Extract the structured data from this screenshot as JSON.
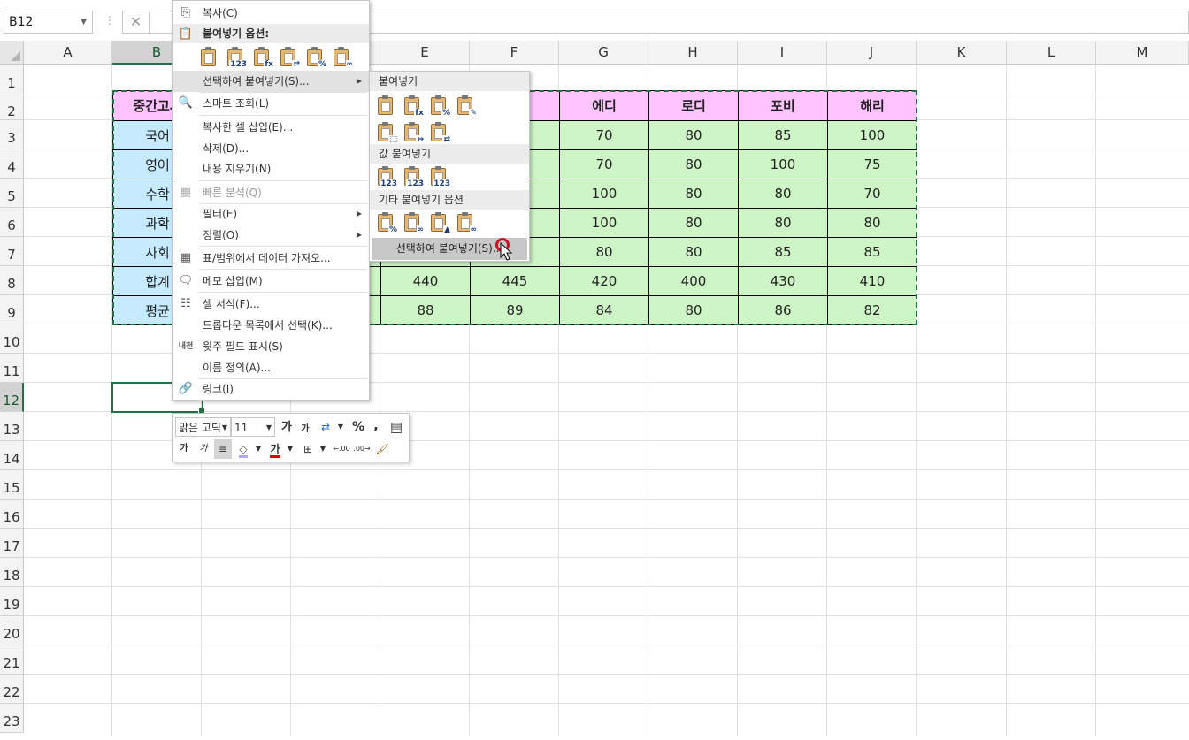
{
  "formula_bar": {
    "name_box": "B12",
    "cancel_icon": "✕",
    "separator": "⋮"
  },
  "columns": [
    "A",
    "B",
    "C",
    "D",
    "E",
    "F",
    "G",
    "H",
    "I",
    "J",
    "K",
    "L",
    "M"
  ],
  "rows": [
    "1",
    "2",
    "3",
    "4",
    "5",
    "6",
    "7",
    "8",
    "9",
    "10",
    "11",
    "12",
    "13",
    "14",
    "15",
    "16",
    "17",
    "18",
    "19",
    "20",
    "21",
    "22",
    "23"
  ],
  "table": {
    "corner": "중간고사",
    "headers_visible": [
      "에디",
      "로디",
      "포비",
      "해리"
    ],
    "row_labels": [
      "국어",
      "영어",
      "수학",
      "과학",
      "사회",
      "합계",
      "평균"
    ],
    "E_values": [
      "",
      "",
      "",
      "",
      "",
      "440",
      "88"
    ],
    "F_values": [
      "",
      "",
      "",
      "",
      "",
      "445",
      "89"
    ],
    "grid": [
      [
        "70",
        "80",
        "85",
        "100"
      ],
      [
        "70",
        "80",
        "100",
        "75"
      ],
      [
        "100",
        "80",
        "80",
        "70"
      ],
      [
        "100",
        "80",
        "80",
        "80"
      ],
      [
        "80",
        "80",
        "85",
        "85"
      ],
      [
        "420",
        "400",
        "430",
        "410"
      ],
      [
        "84",
        "80",
        "86",
        "82"
      ]
    ]
  },
  "context_menu": {
    "copy": "복사(C)",
    "paste_options": "붙여넣기 옵션:",
    "paste_special": "선택하여 붙여넣기(S)...",
    "smart_lookup": "스마트 조회(L)",
    "insert_copied": "복사한 셀 삽입(E)...",
    "delete": "삭제(D)...",
    "clear": "내용 지우기(N)",
    "quick_analysis": "빠른 분석(Q)",
    "filter": "필터(E)",
    "sort": "정렬(O)",
    "get_data": "표/범위에서 데이터 가져오...",
    "insert_comment": "메모 삽입(M)",
    "format_cells": "셀 서식(F)...",
    "pick_dropdown": "드롭다운 목록에서 선택(K)...",
    "phonetic": "윗주 필드 표시(S)",
    "define_name": "이름 정의(A)...",
    "link": "링크(I)"
  },
  "submenu": {
    "paste_header": "붙여넣기",
    "values_header": "값 붙여넣기",
    "other_header": "기타 붙여넣기 옵션",
    "footer": "선택하여 붙여넣기(S)..."
  },
  "mini_toolbar": {
    "font_name": "맑은 고딕",
    "font_size": "11",
    "grow": "가",
    "shrink": "가",
    "percent": "%",
    "comma": ",",
    "bold": "가",
    "italic": "가",
    "font_color": "가",
    "inc_decimal": ".00",
    "dec_decimal": ".00"
  },
  "colors": {
    "accent": "#217346",
    "header_fill": "#ffc3ff",
    "label_fill": "#c6eaff",
    "data_fill": "#cdf5c5"
  }
}
